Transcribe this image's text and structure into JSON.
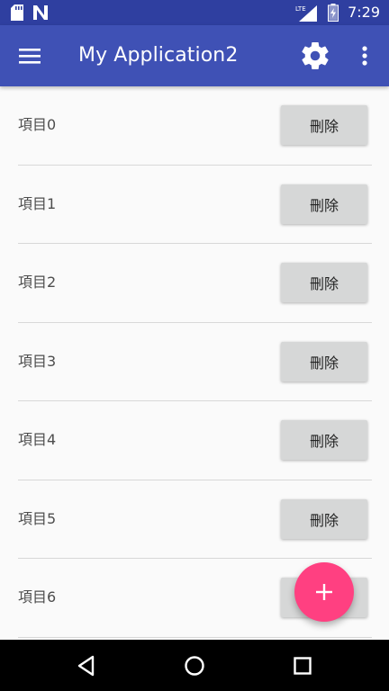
{
  "status_bar": {
    "network": "LTE",
    "time": "7:29"
  },
  "app_bar": {
    "title": "My Application2",
    "menu_icon": "hamburger-menu-icon",
    "settings_icon": "gear-icon",
    "overflow_icon": "more-vert-icon"
  },
  "items": [
    {
      "label": "項目0",
      "button": "刪除"
    },
    {
      "label": "項目1",
      "button": "刪除"
    },
    {
      "label": "項目2",
      "button": "刪除"
    },
    {
      "label": "項目3",
      "button": "刪除"
    },
    {
      "label": "項目4",
      "button": "刪除"
    },
    {
      "label": "項目5",
      "button": "刪除"
    },
    {
      "label": "項目6",
      "button": "刪除"
    }
  ],
  "fab": {
    "icon": "plus-icon",
    "color": "#ff4081"
  },
  "colors": {
    "status_bar": "#2f3fa0",
    "app_bar": "#3f51b5",
    "background": "#fafafa",
    "button": "#d6d7d7"
  },
  "nav_bar": {
    "back_icon": "back-triangle-icon",
    "home_icon": "home-circle-icon",
    "recents_icon": "recents-square-icon"
  }
}
